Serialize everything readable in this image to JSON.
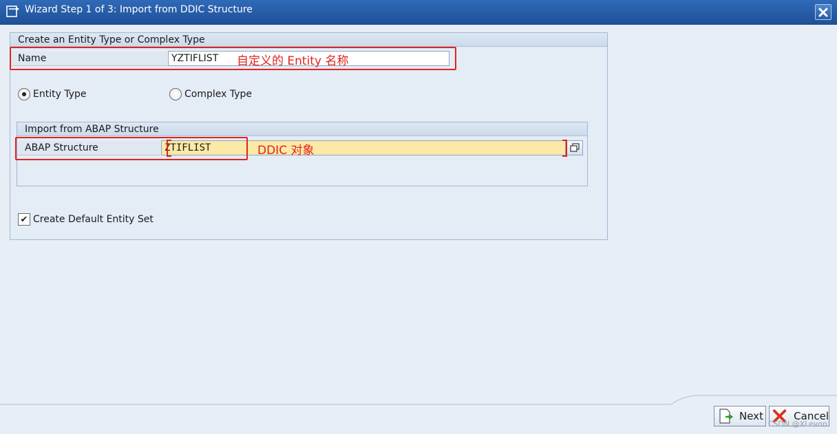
{
  "window": {
    "title": "Wizard Step 1 of 3: Import from DDIC Structure"
  },
  "entity_group": {
    "title": "Create an Entity Type or Complex Type",
    "name_label": "Name",
    "name_value": "YZTIFLIST",
    "name_annotation": "自定义的 Entity 名称",
    "radio_entity_type": "Entity Type",
    "radio_complex_type": "Complex Type",
    "selected_type": "Entity Type"
  },
  "import_group": {
    "title": "Import from ABAP Structure",
    "structure_label": "ABAP Structure",
    "structure_value": "ZTIFLIST",
    "structure_annotation": "DDIC 对象"
  },
  "default_set": {
    "label": "Create Default Entity Set",
    "checked": true
  },
  "buttons": {
    "next": "Next",
    "cancel": "Cancel"
  },
  "watermark": "CSDN @XLevon",
  "colors": {
    "title_bar": "#2f6ab8",
    "annotation_red": "#e0241c",
    "input_highlight": "#fbe9a5"
  }
}
